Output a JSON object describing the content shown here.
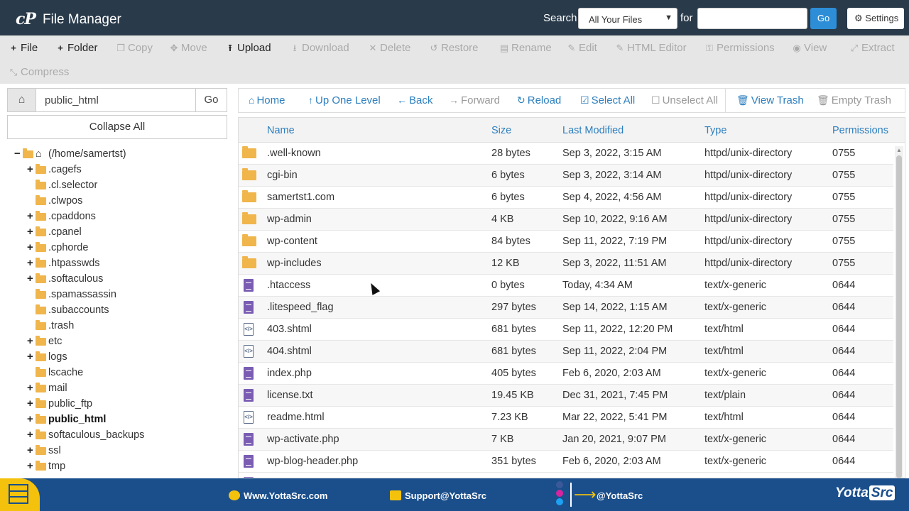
{
  "header": {
    "logo": "cP",
    "title": "File Manager",
    "search_label": "Search",
    "search_scope": "All Your Files",
    "for_label": "for",
    "search_value": "",
    "go_label": "Go",
    "settings_label": "Settings"
  },
  "toolbar": {
    "items": [
      {
        "label": "File",
        "icon": "plus-icon",
        "glyph": "+",
        "enabled": true
      },
      {
        "label": "Folder",
        "icon": "plus-icon",
        "glyph": "+",
        "enabled": true
      },
      {
        "label": "Copy",
        "icon": "copy-icon",
        "glyph": "❐",
        "enabled": false
      },
      {
        "label": "Move",
        "icon": "move-icon",
        "glyph": "✥",
        "enabled": false
      },
      {
        "label": "Upload",
        "icon": "upload-icon",
        "glyph": "⭱",
        "enabled": true
      },
      {
        "label": "Download",
        "icon": "download-icon",
        "glyph": "⭳",
        "enabled": false
      },
      {
        "label": "Delete",
        "icon": "delete-icon",
        "glyph": "✕",
        "enabled": false
      },
      {
        "label": "Restore",
        "icon": "restore-icon",
        "glyph": "↺",
        "enabled": false
      },
      {
        "label": "Rename",
        "icon": "rename-icon",
        "glyph": "▤",
        "enabled": false
      },
      {
        "label": "Edit",
        "icon": "pencil-icon",
        "glyph": "✎",
        "enabled": false
      },
      {
        "label": "HTML Editor",
        "icon": "html-editor-icon",
        "glyph": "✎",
        "enabled": false
      },
      {
        "label": "Permissions",
        "icon": "key-icon",
        "glyph": "⚿",
        "enabled": false
      },
      {
        "label": "View",
        "icon": "eye-icon",
        "glyph": "◉",
        "enabled": false
      },
      {
        "label": "Extract",
        "icon": "extract-icon",
        "glyph": "⤢",
        "enabled": false
      },
      {
        "label": "Compress",
        "icon": "compress-icon",
        "glyph": "⤡",
        "enabled": false
      }
    ]
  },
  "path_bar": {
    "value": "public_html",
    "go_label": "Go",
    "collapse_label": "Collapse All"
  },
  "tree": [
    {
      "label": "(/home/samertst)",
      "toggle": "−",
      "level": 0,
      "open": true
    },
    {
      "label": ".cagefs",
      "toggle": "+",
      "level": 1
    },
    {
      "label": ".cl.selector",
      "toggle": "",
      "level": 1
    },
    {
      "label": ".clwpos",
      "toggle": "",
      "level": 1
    },
    {
      "label": ".cpaddons",
      "toggle": "+",
      "level": 1
    },
    {
      "label": ".cpanel",
      "toggle": "+",
      "level": 1
    },
    {
      "label": ".cphorde",
      "toggle": "+",
      "level": 1
    },
    {
      "label": ".htpasswds",
      "toggle": "+",
      "level": 1
    },
    {
      "label": ".softaculous",
      "toggle": "+",
      "level": 1
    },
    {
      "label": ".spamassassin",
      "toggle": "",
      "level": 1
    },
    {
      "label": ".subaccounts",
      "toggle": "",
      "level": 1
    },
    {
      "label": ".trash",
      "toggle": "",
      "level": 1
    },
    {
      "label": "etc",
      "toggle": "+",
      "level": 1
    },
    {
      "label": "logs",
      "toggle": "+",
      "level": 1
    },
    {
      "label": "lscache",
      "toggle": "",
      "level": 1
    },
    {
      "label": "mail",
      "toggle": "+",
      "level": 1
    },
    {
      "label": "public_ftp",
      "toggle": "+",
      "level": 1
    },
    {
      "label": "public_html",
      "toggle": "+",
      "level": 1,
      "selected": true
    },
    {
      "label": "softaculous_backups",
      "toggle": "+",
      "level": 1
    },
    {
      "label": "ssl",
      "toggle": "+",
      "level": 1
    },
    {
      "label": "tmp",
      "toggle": "+",
      "level": 1
    }
  ],
  "nav": {
    "items": [
      {
        "label": "Home",
        "glyph": "⌂",
        "icon": "home-icon",
        "enabled": true
      },
      {
        "label": "Up One Level",
        "glyph": "↑",
        "icon": "up-arrow-icon",
        "enabled": true
      },
      {
        "label": "Back",
        "glyph": "←",
        "icon": "back-arrow-icon",
        "enabled": true
      },
      {
        "label": "Forward",
        "glyph": "→",
        "icon": "forward-arrow-icon",
        "enabled": false
      },
      {
        "label": "Reload",
        "glyph": "↻",
        "icon": "reload-icon",
        "enabled": true
      },
      {
        "label": "Select All",
        "glyph": "☑",
        "icon": "checkbox-checked-icon",
        "enabled": true
      },
      {
        "label": "Unselect All",
        "glyph": "☐",
        "icon": "checkbox-empty-icon",
        "enabled": false
      },
      {
        "label": "View Trash",
        "glyph": "🗑",
        "icon": "trash-icon",
        "enabled": true
      },
      {
        "label": "Empty Trash",
        "glyph": "🗑",
        "icon": "trash-icon",
        "enabled": false
      }
    ]
  },
  "table": {
    "columns": [
      "Name",
      "Size",
      "Last Modified",
      "Type",
      "Permissions"
    ],
    "rows": [
      {
        "icon": "folder",
        "name": ".well-known",
        "size": "28 bytes",
        "modified": "Sep 3, 2022, 3:15 AM",
        "type": "httpd/unix-directory",
        "perms": "0755"
      },
      {
        "icon": "folder",
        "name": "cgi-bin",
        "size": "6 bytes",
        "modified": "Sep 3, 2022, 3:14 AM",
        "type": "httpd/unix-directory",
        "perms": "0755"
      },
      {
        "icon": "folder",
        "name": "samertst1.com",
        "size": "6 bytes",
        "modified": "Sep 4, 2022, 4:56 AM",
        "type": "httpd/unix-directory",
        "perms": "0755"
      },
      {
        "icon": "folder",
        "name": "wp-admin",
        "size": "4 KB",
        "modified": "Sep 10, 2022, 9:16 AM",
        "type": "httpd/unix-directory",
        "perms": "0755"
      },
      {
        "icon": "folder",
        "name": "wp-content",
        "size": "84 bytes",
        "modified": "Sep 11, 2022, 7:19 PM",
        "type": "httpd/unix-directory",
        "perms": "0755"
      },
      {
        "icon": "folder",
        "name": "wp-includes",
        "size": "12 KB",
        "modified": "Sep 3, 2022, 11:51 AM",
        "type": "httpd/unix-directory",
        "perms": "0755"
      },
      {
        "icon": "doc",
        "name": ".htaccess",
        "size": "0 bytes",
        "modified": "Today, 4:34 AM",
        "type": "text/x-generic",
        "perms": "0644"
      },
      {
        "icon": "doc",
        "name": ".litespeed_flag",
        "size": "297 bytes",
        "modified": "Sep 14, 2022, 1:15 AM",
        "type": "text/x-generic",
        "perms": "0644"
      },
      {
        "icon": "code",
        "name": "403.shtml",
        "size": "681 bytes",
        "modified": "Sep 11, 2022, 12:20 PM",
        "type": "text/html",
        "perms": "0644"
      },
      {
        "icon": "code",
        "name": "404.shtml",
        "size": "681 bytes",
        "modified": "Sep 11, 2022, 2:04 PM",
        "type": "text/html",
        "perms": "0644"
      },
      {
        "icon": "doc",
        "name": "index.php",
        "size": "405 bytes",
        "modified": "Feb 6, 2020, 2:03 AM",
        "type": "text/x-generic",
        "perms": "0644"
      },
      {
        "icon": "doc",
        "name": "license.txt",
        "size": "19.45 KB",
        "modified": "Dec 31, 2021, 7:45 PM",
        "type": "text/plain",
        "perms": "0644"
      },
      {
        "icon": "code",
        "name": "readme.html",
        "size": "7.23 KB",
        "modified": "Mar 22, 2022, 5:41 PM",
        "type": "text/html",
        "perms": "0644"
      },
      {
        "icon": "doc",
        "name": "wp-activate.php",
        "size": "7 KB",
        "modified": "Jan 20, 2021, 9:07 PM",
        "type": "text/x-generic",
        "perms": "0644"
      },
      {
        "icon": "doc",
        "name": "wp-blog-header.php",
        "size": "351 bytes",
        "modified": "Feb 6, 2020, 2:03 AM",
        "type": "text/x-generic",
        "perms": "0644"
      }
    ]
  },
  "footer": {
    "website": "Www.YottaSrc.com",
    "email": "Support@YottaSrc",
    "social": "@YottaSrc",
    "brand_a": "Yotta",
    "brand_b": "Src"
  },
  "colors": {
    "header_bg": "#293a4a",
    "accent": "#2d8ed7",
    "link": "#2d7fbf",
    "folder": "#f0b54b",
    "doc": "#7a5db3",
    "footer_bg": "#1a4f8c",
    "footer_accent": "#f4c20d"
  }
}
